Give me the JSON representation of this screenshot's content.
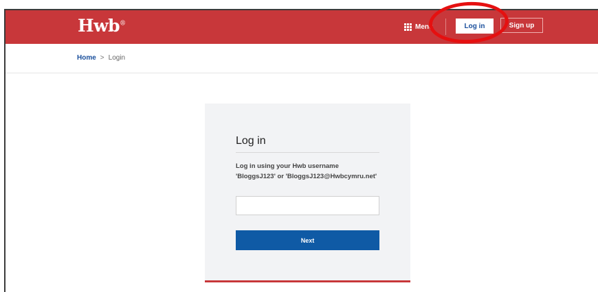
{
  "header": {
    "logo": "Hwb",
    "logo_mark": "®",
    "menu_label": "Menu",
    "login_label": "Log in",
    "signup_label": "Sign up",
    "background_color": "#c8373a"
  },
  "annotation": {
    "color": "#e51010"
  },
  "breadcrumb": {
    "home": "Home",
    "separator": ">",
    "current": "Login"
  },
  "login_card": {
    "title": "Log in",
    "description": "Log in using your Hwb username 'BloggsJ123' or 'BloggsJ123@Hwbcymru.net'",
    "username_value": "",
    "next_label": "Next",
    "button_color": "#0f5aa5"
  }
}
